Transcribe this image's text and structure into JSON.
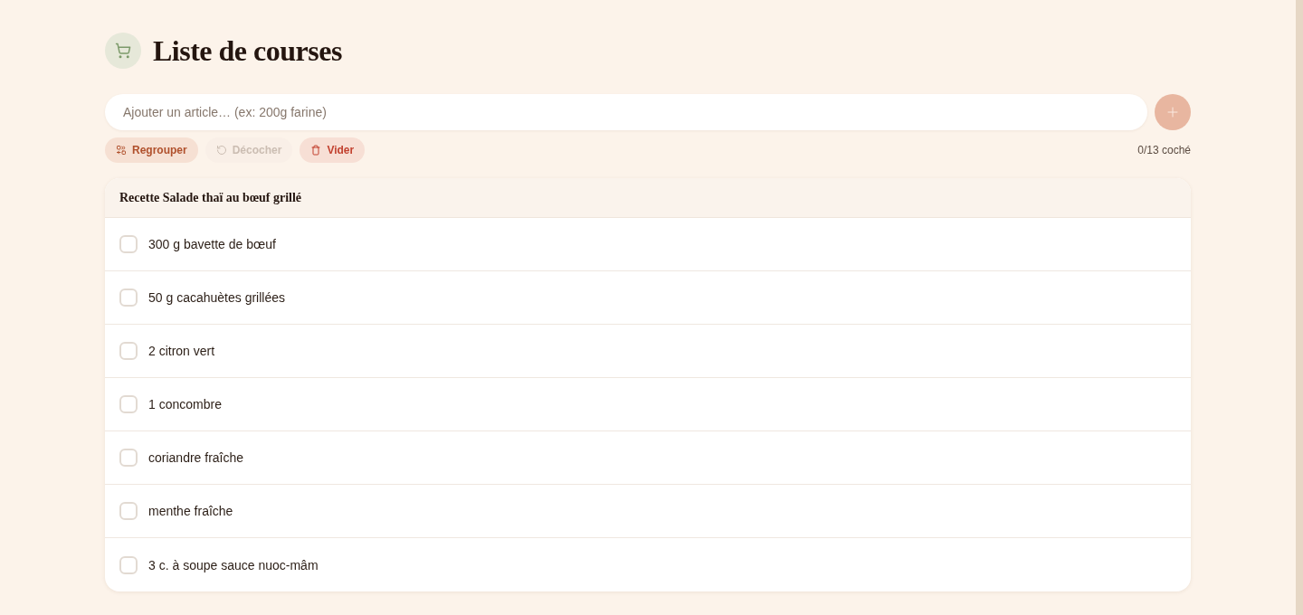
{
  "header": {
    "title": "Liste de courses"
  },
  "add_item": {
    "placeholder": "Ajouter un article… (ex: 200g farine)",
    "add_button": {
      "disabled": true
    }
  },
  "actions": [
    {
      "kind": "group",
      "label": "Regrouper",
      "disabled": false
    },
    {
      "kind": "uncheck",
      "label": "Décocher",
      "disabled": true
    },
    {
      "kind": "clear",
      "label": "Vider",
      "disabled": false
    }
  ],
  "progress_text": "0/13 coché",
  "groups": [
    {
      "title": "Recette Salade thaï au bœuf grillé",
      "items": [
        {
          "label": "300 g bavette de bœuf",
          "checked": false
        },
        {
          "label": "50 g cacahuètes grillées",
          "checked": false
        },
        {
          "label": "2 citron vert",
          "checked": false
        },
        {
          "label": "1 concombre",
          "checked": false
        },
        {
          "label": "coriandre fraîche",
          "checked": false
        },
        {
          "label": "menthe fraîche",
          "checked": false
        },
        {
          "label": "3 c. à soupe sauce nuoc-mâm",
          "checked": false
        }
      ]
    }
  ]
}
